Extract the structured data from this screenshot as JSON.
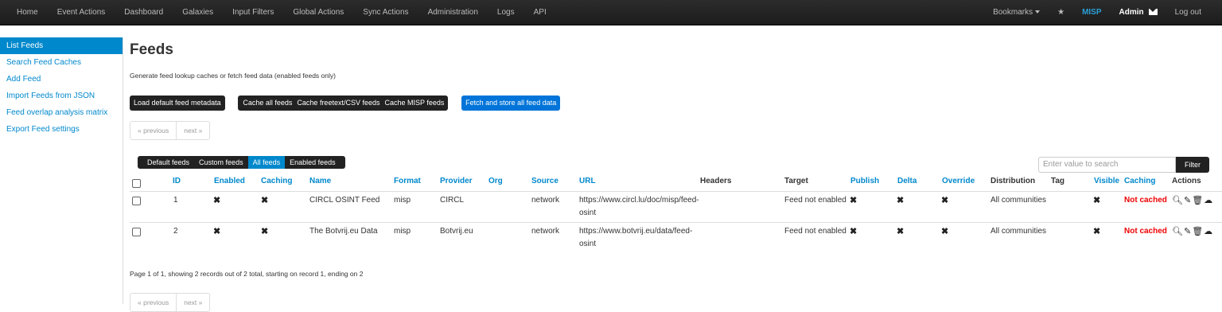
{
  "nav": {
    "left": [
      "Home",
      "Event Actions",
      "Dashboard",
      "Galaxies",
      "Input Filters",
      "Global Actions",
      "Sync Actions",
      "Administration",
      "Logs",
      "API"
    ],
    "bookmarks": "Bookmarks",
    "org": "MISP",
    "user": "Admin",
    "logout": "Log out"
  },
  "sidebar": {
    "items": [
      {
        "label": "List Feeds",
        "active": true
      },
      {
        "label": "Search Feed Caches"
      },
      {
        "label": "Add Feed"
      },
      {
        "label": "Import Feeds from JSON"
      },
      {
        "label": "Feed overlap analysis matrix"
      },
      {
        "label": "Export Feed settings"
      }
    ]
  },
  "page": {
    "title": "Feeds",
    "description": "Generate feed lookup caches or fetch feed data (enabled feeds only)",
    "buttons": {
      "load_default": "Load default feed metadata",
      "cache_all": "Cache all feeds",
      "cache_freetext": "Cache freetext/CSV feeds",
      "cache_misp": "Cache MISP feeds",
      "fetch_store": "Fetch and store all feed data"
    },
    "pager": {
      "previous": "« previous",
      "next": "next »"
    },
    "tabs": [
      "Default feeds",
      "Custom feeds",
      "All feeds",
      "Enabled feeds"
    ],
    "active_tab": "All feeds",
    "search_placeholder": "Enter value to search",
    "filter": "Filter",
    "footer": "Page 1 of 1, showing 2 records out of 2 total, starting on record 1, ending on 2"
  },
  "table": {
    "headers": {
      "id": "ID",
      "enabled": "Enabled",
      "caching": "Caching",
      "name": "Name",
      "format": "Format",
      "provider": "Provider",
      "org": "Org",
      "source": "Source",
      "url": "URL",
      "headers": "Headers",
      "target": "Target",
      "publish": "Publish",
      "delta": "Delta",
      "override": "Override",
      "distribution": "Distribution",
      "tag": "Tag",
      "visible": "Visible",
      "caching2": "Caching",
      "actions": "Actions"
    },
    "rows": [
      {
        "id": "1",
        "name": "CIRCL OSINT Feed",
        "format": "misp",
        "provider": "CIRCL",
        "source": "network",
        "url_line1": "https://www.circl.lu/doc/misp/feed-",
        "url_line2": "osint",
        "target": "Feed not enabled",
        "distribution": "All communities",
        "caching": "Not cached"
      },
      {
        "id": "2",
        "name": "The Botvrij.eu Data",
        "format": "misp",
        "provider": "Botvrij.eu",
        "source": "network",
        "url_line1": "https://www.botvrij.eu/data/feed-",
        "url_line2": "osint",
        "target": "Feed not enabled",
        "distribution": "All communities",
        "caching": "Not cached"
      }
    ],
    "cross_symbol": "✖",
    "action_icons": [
      "search-icon",
      "edit-icon",
      "trash-icon",
      "cloud-download-icon"
    ]
  }
}
